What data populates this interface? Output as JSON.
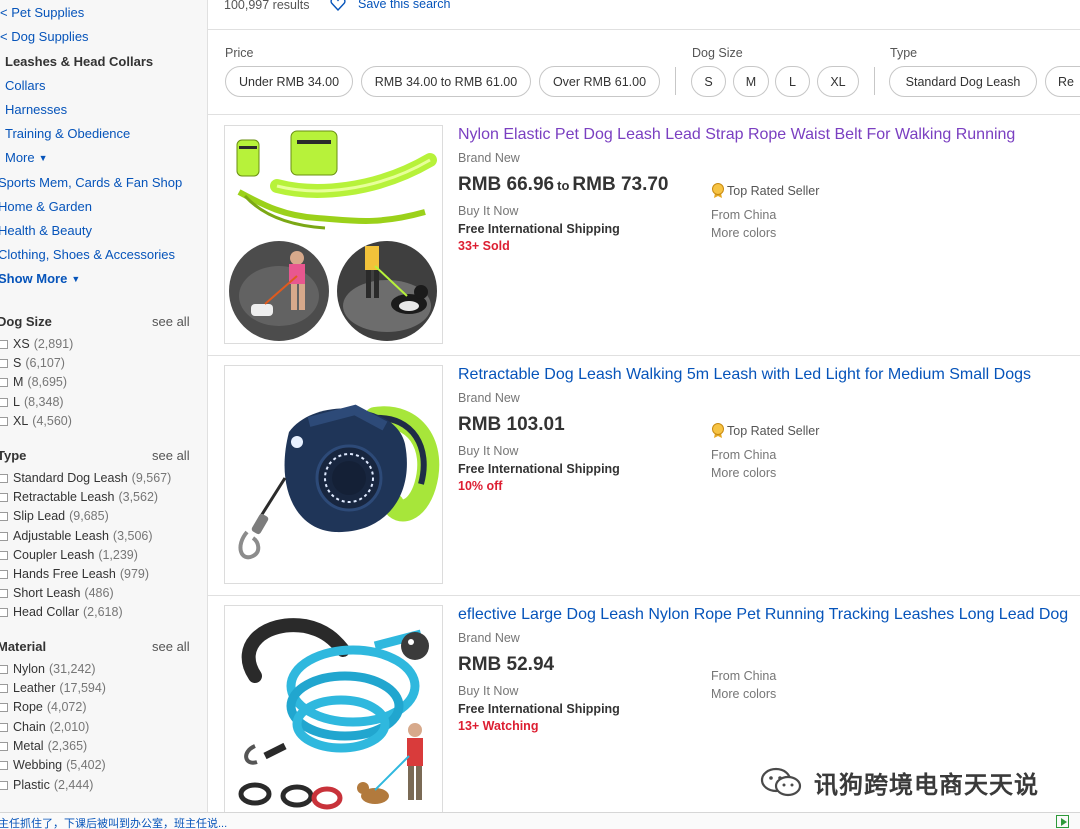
{
  "sidebar": {
    "categories": [
      {
        "label": "Pet Supplies",
        "prefix": "<",
        "selected": false
      },
      {
        "label": "Dog Supplies",
        "prefix": "<",
        "selected": false
      },
      {
        "label": "Leashes & Head Collars",
        "selected": true
      },
      {
        "label": "Collars"
      },
      {
        "label": "Harnesses"
      },
      {
        "label": "Training & Obedience"
      },
      {
        "label": "More"
      },
      {
        "label": "Sports Mem, Cards & Fan Shop"
      },
      {
        "label": "Home & Garden"
      },
      {
        "label": "Health & Beauty"
      },
      {
        "label": "Clothing, Shoes & Accessories"
      },
      {
        "label": "Show More"
      }
    ],
    "see_all_label": "see all",
    "aspects": [
      {
        "title": "Dog Size",
        "items": [
          {
            "label": "XS",
            "count": "(2,891)"
          },
          {
            "label": "S",
            "count": "(6,107)"
          },
          {
            "label": "M",
            "count": "(8,695)"
          },
          {
            "label": "L",
            "count": "(8,348)"
          },
          {
            "label": "XL",
            "count": "(4,560)"
          }
        ]
      },
      {
        "title": "Type",
        "items": [
          {
            "label": "Standard Dog Leash",
            "count": "(9,567)"
          },
          {
            "label": "Retractable Leash",
            "count": "(3,562)"
          },
          {
            "label": "Slip Lead",
            "count": "(9,685)"
          },
          {
            "label": "Adjustable Leash",
            "count": "(3,506)"
          },
          {
            "label": "Coupler Leash",
            "count": "(1,239)"
          },
          {
            "label": "Hands Free Leash",
            "count": "(979)"
          },
          {
            "label": "Short Leash",
            "count": "(486)"
          },
          {
            "label": "Head Collar",
            "count": "(2,618)"
          }
        ]
      },
      {
        "title": "Material",
        "items": [
          {
            "label": "Nylon",
            "count": "(31,242)"
          },
          {
            "label": "Leather",
            "count": "(17,594)"
          },
          {
            "label": "Rope",
            "count": "(4,072)"
          },
          {
            "label": "Chain",
            "count": "(2,010)"
          },
          {
            "label": "Metal",
            "count": "(2,365)"
          },
          {
            "label": "Webbing",
            "count": "(5,402)"
          },
          {
            "label": "Plastic",
            "count": "(2,444)"
          }
        ]
      }
    ]
  },
  "topbar": {
    "results": "100,997 results",
    "save_search": "Save this search"
  },
  "filters": {
    "price_label": "Price",
    "price_options": [
      "Under RMB 34.00",
      "RMB 34.00 to RMB 61.00",
      "Over RMB 61.00"
    ],
    "size_label": "Dog Size",
    "size_options": [
      "S",
      "M",
      "L",
      "XL"
    ],
    "type_label": "Type",
    "type_options": [
      "Standard Dog Leash",
      "Re"
    ]
  },
  "listings": [
    {
      "title": "Nylon Elastic Pet Dog Leash Lead Strap Rope Waist Belt For Walking Running",
      "condition": "Brand New",
      "price_low": "RMB 66.96",
      "price_to": "to",
      "price_high": "RMB 73.70",
      "format": "Buy It Now",
      "shipping": "Free International Shipping",
      "hotness": "33+ Sold",
      "seller_badge": "Top Rated Seller",
      "location": "From China",
      "more_colors": "More colors",
      "image": "hands-free waist belt dog leash product photo"
    },
    {
      "title": "Retractable Dog Leash Walking 5m Leash with Led Light for Medium Small Dogs",
      "condition": "Brand New",
      "price": "RMB 103.01",
      "format": "Buy It Now",
      "shipping": "Free International Shipping",
      "hotness": "10% off",
      "seller_badge": "Top Rated Seller",
      "location": "From China",
      "more_colors": "More colors",
      "image": "retractable leash with LED light product photo"
    },
    {
      "title": "eflective Large Dog Leash Nylon Rope Pet Running Tracking Leashes Long Lead Dog",
      "condition": "Brand New",
      "price": "RMB 52.94",
      "format": "Buy It Now",
      "shipping": "Free International Shipping",
      "hotness": "13+ Watching",
      "location": "From China",
      "more_colors": "More colors",
      "image": "reflective rope leash product photo"
    }
  ],
  "bottom_strip": "主任抓住了，下课后被叫到办公室，班主任说...",
  "watermark": "讯狗跨境电商天天说",
  "colors": {
    "link": "#0654ba",
    "visited": "#7a3fc1",
    "hot": "#dd1e31",
    "neon": "#b7f23a"
  }
}
